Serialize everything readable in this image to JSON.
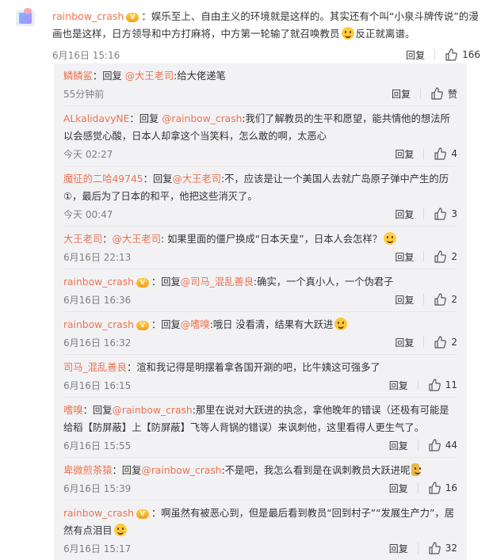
{
  "main_comment": {
    "user": "rainbow_crash",
    "text_before": "：娱乐至上、自由主义的环境就是这样的。其实还有个叫“小泉斗牌传说”的漫画也是这样，日方领导和中方打麻将，中方第一轮输了就召唤教员",
    "text_after": "反正就离谱。",
    "time": "6月16日 15:16",
    "reply_label": "回复",
    "likes": "166"
  },
  "replies": [
    {
      "user": "鳞鳞鲨",
      "pre": "：回复 ",
      "mention": "@大王老司",
      "post": ":给大佬递笔",
      "time": "55分钟前",
      "reply_label": "回复",
      "likes": "赞",
      "vip": false,
      "emoji": ""
    },
    {
      "user": "ALkalidavyNE",
      "pre": "：回复 ",
      "mention": "@rainbow_crash",
      "post": ":我们了解教员的生平和愿望，能共情他的想法所以会感觉心酸，日本人却拿这个当笑料，怎么敢的啊，太恶心",
      "time": "今天 02:27",
      "reply_label": "回复",
      "likes": "4",
      "vip": false,
      "emoji": ""
    },
    {
      "user": "魔征的二哈49745",
      "pre": "：回复",
      "mention": "@大王老司",
      "post": ":不，应该是让一个美国人去就广岛原子弹中产生的历①，最后为了日本的和平，他把这些消灭了。",
      "time": "今天 00:47",
      "reply_label": "回复",
      "likes": "3",
      "vip": false,
      "emoji": ""
    },
    {
      "user": "大王老司",
      "pre": "：",
      "mention": "@大王老司",
      "post": ": 如果里面的僵尸换成“日本天皇”，日本人会怎样？",
      "time": "6月16日 22:13",
      "reply_label": "回复",
      "likes": "2",
      "vip": false,
      "emoji": "think"
    },
    {
      "user": "rainbow_crash",
      "pre": "：回复",
      "mention": "@司马_混乱善良",
      "post": ":确实，一个真小人，一个伪君子",
      "time": "6月16日 16:36",
      "reply_label": "回复",
      "likes": "2",
      "vip": true,
      "emoji": ""
    },
    {
      "user": "rainbow_crash",
      "pre": "：回复",
      "mention": "@嗜嗅",
      "post": ":哦日 没看清，结果有大跃进",
      "time": "6月16日 16:32",
      "reply_label": "回复",
      "likes": "2",
      "vip": true,
      "emoji": "laugh"
    },
    {
      "user": "司马_混乱善良",
      "pre": "：",
      "mention": "",
      "post": "渲和我记得是明摆着拿各国开涮的吧，比牛姨这可强多了",
      "time": "6月16日 16:15",
      "reply_label": "回复",
      "likes": "11",
      "vip": false,
      "emoji": ""
    },
    {
      "user": "嗜嗅",
      "pre": "：回复",
      "mention": "@rainbow_crash",
      "post": ":那里在说对大跃进的执念，拿他晚年的错误（还极有可能是给稻【防屏蔽】上【防屏蔽】飞等人背锅的错误）来讽刺他，这里看得人更生气了。",
      "time": "6月16日 15:55",
      "reply_label": "回复",
      "likes": "44",
      "vip": false,
      "emoji": ""
    },
    {
      "user": "卑微煎茶猿",
      "pre": "：回复",
      "mention": "@rainbow_crash",
      "post": ":不是吧，我怎么看到是在讽刺教员大跃进呢",
      "time": "6月16日 15:39",
      "reply_label": "回复",
      "likes": "16",
      "vip": false,
      "emoji": "fishy"
    },
    {
      "user": "rainbow_crash",
      "pre": "：",
      "mention": "",
      "post": "啊虽然有被恶心到，但是最后看到教员“回到村子”“发展生产力”，居然有点泪目",
      "time": "6月16日 15:17",
      "reply_label": "回复",
      "likes": "32",
      "vip": true,
      "emoji": "laugh"
    }
  ]
}
